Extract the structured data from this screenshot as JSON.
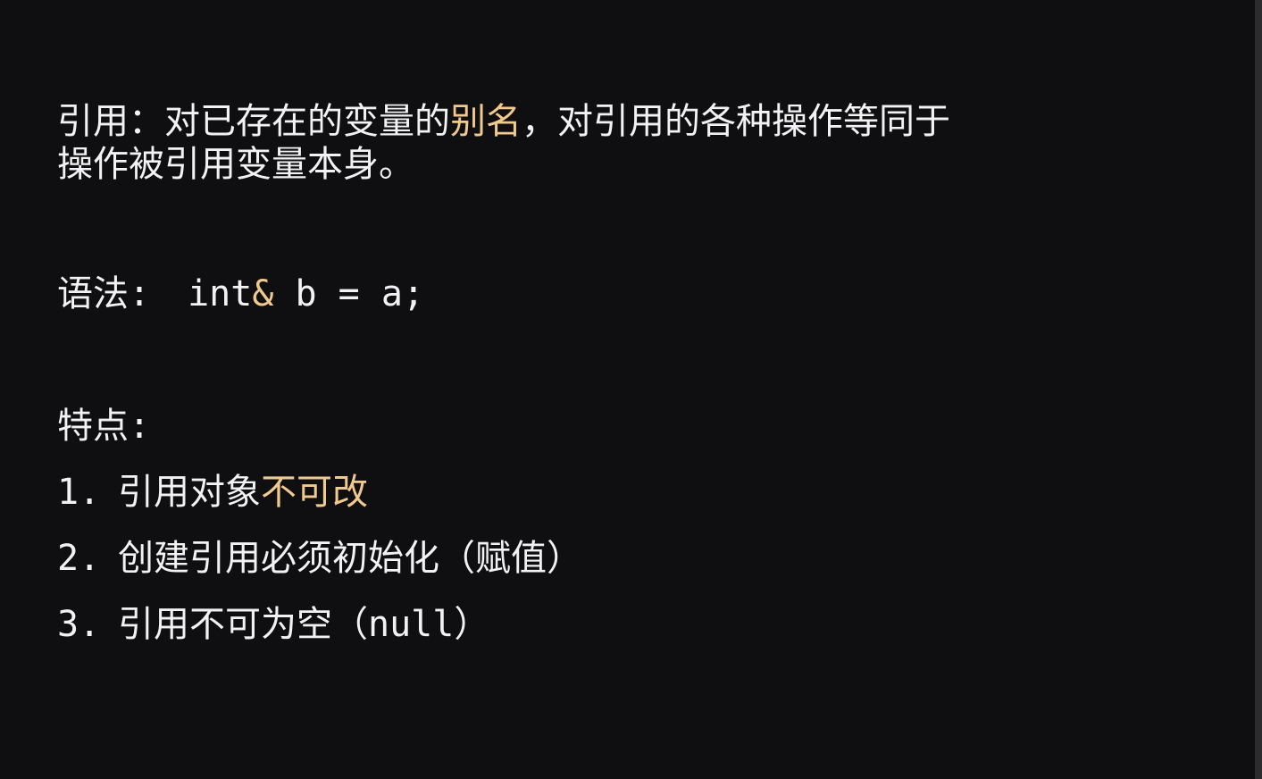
{
  "definition": {
    "label": "引用：",
    "text_before": "对已存在的变量的",
    "highlight": "别名",
    "text_after": "，对引用的各种操作等同于",
    "line2": "操作被引用变量本身。"
  },
  "syntax": {
    "label": "语法:",
    "code_keyword": "int",
    "code_amp": "&",
    "code_rest": " b = a;"
  },
  "features": {
    "title": "特点:",
    "items": [
      {
        "num": "1.",
        "text_before": "引用对象",
        "highlight": "不可改",
        "text_after": ""
      },
      {
        "num": "2.",
        "text_before": "创建引用必须初始化（赋值）",
        "highlight": "",
        "text_after": ""
      },
      {
        "num": "3.",
        "text_before": "引用不可为空（null）",
        "highlight": "",
        "text_after": ""
      }
    ]
  },
  "colors": {
    "background": "#0f0f12",
    "text": "#f2f2f2",
    "accent": "#f0c98e"
  }
}
